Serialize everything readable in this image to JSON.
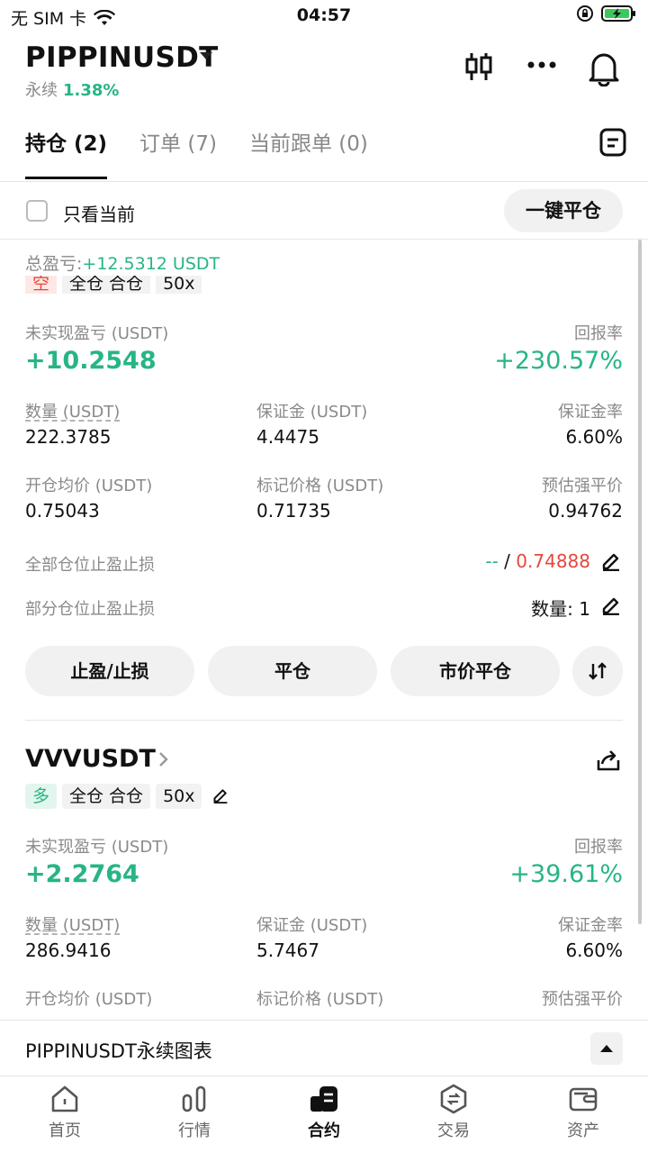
{
  "status_bar": {
    "carrier": "无 SIM 卡",
    "time": "04:57"
  },
  "header": {
    "symbol": "PIPPINUSDT",
    "type": "永续",
    "change": "1.38%"
  },
  "tabs": [
    "持仓 (2)",
    "订单 (7)",
    "当前跟单 (0)"
  ],
  "filter": {
    "only_current": "只看当前",
    "close_all": "一键平仓"
  },
  "total_pnl": {
    "label": "总盈亏:",
    "value": "+12.5312 USDT"
  },
  "position1": {
    "tags": [
      "空",
      "全仓 合仓",
      "50x"
    ],
    "unrealized_label": "未实现盈亏 (USDT)",
    "unrealized": "+10.2548",
    "roi_label": "回报率",
    "roi": "+230.57%",
    "qty_label": "数量 (USDT)",
    "qty": "222.3785",
    "margin_label": "保证金 (USDT)",
    "margin": "4.4475",
    "margin_rate_label": "保证金率",
    "margin_rate": "6.60%",
    "entry_label": "开仓均价 (USDT)",
    "entry": "0.75043",
    "mark_label": "标记价格 (USDT)",
    "mark": "0.71735",
    "liq_label": "预估强平价",
    "liq": "0.94762",
    "tpsl_all_label": "全部仓位止盈止损",
    "tpsl_all_tp": "--",
    "tpsl_all_sl": "0.74888",
    "tpsl_part_label": "部分仓位止盈止损",
    "tpsl_part_value": "数量: 1",
    "buttons": [
      "止盈/止损",
      "平仓",
      "市价平仓"
    ]
  },
  "position2": {
    "symbol": "VVVUSDT",
    "tags": [
      "多",
      "全仓 合仓",
      "50x"
    ],
    "unrealized_label": "未实现盈亏 (USDT)",
    "unrealized": "+2.2764",
    "roi_label": "回报率",
    "roi": "+39.61%",
    "qty_label": "数量 (USDT)",
    "qty": "286.9416",
    "margin_label": "保证金 (USDT)",
    "margin": "5.7467",
    "margin_rate_label": "保证金率",
    "margin_rate": "6.60%",
    "entry_label": "开仓均价 (USDT)",
    "mark_label": "标记价格 (USDT)",
    "liq_label": "预估强平价"
  },
  "chart_bar": {
    "title": "PIPPINUSDT永续图表"
  },
  "nav": [
    "首页",
    "行情",
    "合约",
    "交易",
    "资产"
  ],
  "colors": {
    "green": "#27b584",
    "red": "#e5483d"
  }
}
